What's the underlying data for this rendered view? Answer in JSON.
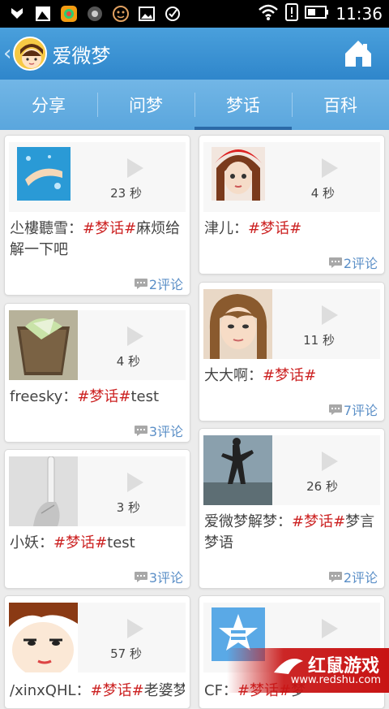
{
  "status_bar": {
    "time": "11:36"
  },
  "app_bar": {
    "back": "‹",
    "title": "爱微梦"
  },
  "tabs": [
    {
      "label": "分享"
    },
    {
      "label": "问梦"
    },
    {
      "label": "梦话",
      "active": true
    },
    {
      "label": "百科"
    }
  ],
  "cards": [
    {
      "duration": "23 秒",
      "author": "尐樓聽雪：",
      "tag": "#梦话#",
      "text": "麻烦给解一下吧",
      "comments": "2评论"
    },
    {
      "duration": "4 秒",
      "author": "津儿：",
      "tag": "#梦话#",
      "text": "",
      "comments": "2评论"
    },
    {
      "duration": "4 秒",
      "author": "freesky：",
      "tag": "#梦话#",
      "text": "test",
      "comments": "3评论"
    },
    {
      "duration": "11 秒",
      "author": "大大啊：",
      "tag": "#梦话#",
      "text": "",
      "comments": "7评论"
    },
    {
      "duration": "3 秒",
      "author": "小妖：",
      "tag": "#梦话#",
      "text": "test",
      "comments": "3评论"
    },
    {
      "duration": "26 秒",
      "author": "爱微梦解梦：",
      "tag": "#梦话#",
      "text": "梦言梦语",
      "comments": "2评论"
    },
    {
      "duration": "57 秒",
      "author": "/xinxQHL：",
      "tag": "#梦话#",
      "text": "老婆梦",
      "comments": ""
    },
    {
      "duration": "",
      "author": "CF：",
      "tag": "#梦话#",
      "text": "梦",
      "comments": ""
    }
  ],
  "watermark": {
    "title": "红鼠游戏",
    "url": "www.redshu.com"
  }
}
